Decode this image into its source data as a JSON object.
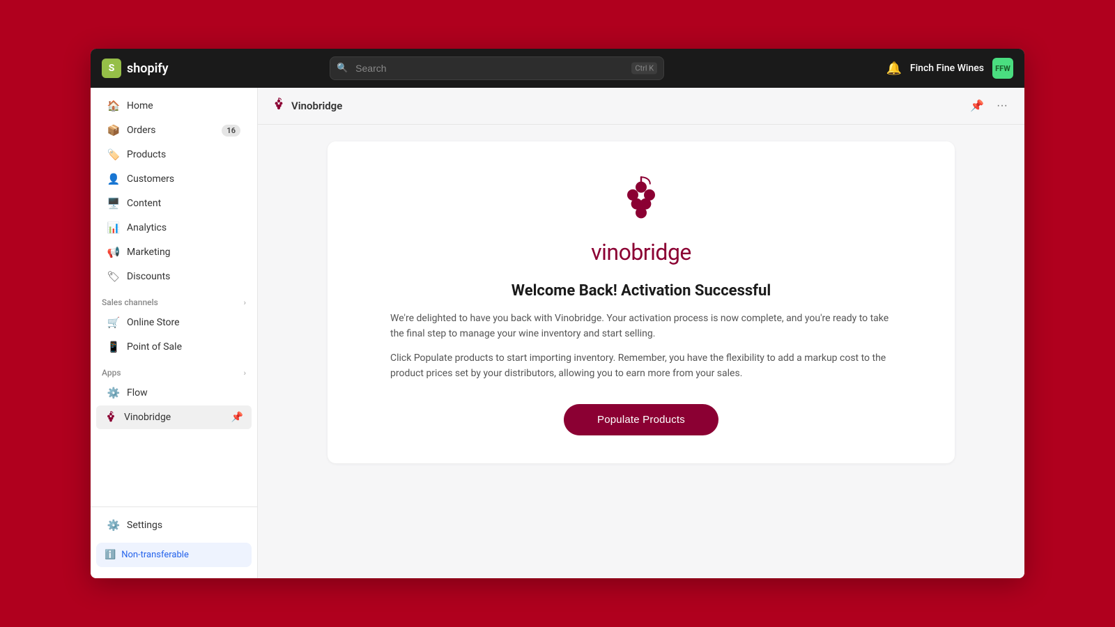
{
  "topbar": {
    "logo_text": "shopify",
    "search_placeholder": "Search",
    "search_shortcut": "Ctrl K",
    "store_name": "Finch Fine Wines",
    "store_initials": "FFW"
  },
  "sidebar": {
    "nav_items": [
      {
        "id": "home",
        "label": "Home",
        "icon": "home"
      },
      {
        "id": "orders",
        "label": "Orders",
        "icon": "orders",
        "badge": "16"
      },
      {
        "id": "products",
        "label": "Products",
        "icon": "products"
      },
      {
        "id": "customers",
        "label": "Customers",
        "icon": "customers"
      },
      {
        "id": "content",
        "label": "Content",
        "icon": "content"
      },
      {
        "id": "analytics",
        "label": "Analytics",
        "icon": "analytics"
      },
      {
        "id": "marketing",
        "label": "Marketing",
        "icon": "marketing"
      },
      {
        "id": "discounts",
        "label": "Discounts",
        "icon": "discounts"
      }
    ],
    "sales_channels_label": "Sales channels",
    "sales_channels": [
      {
        "id": "online-store",
        "label": "Online Store",
        "icon": "store"
      },
      {
        "id": "point-of-sale",
        "label": "Point of Sale",
        "icon": "pos"
      }
    ],
    "apps_label": "Apps",
    "apps": [
      {
        "id": "flow",
        "label": "Flow",
        "icon": "flow"
      },
      {
        "id": "vinobridge",
        "label": "Vinobridge",
        "icon": "grape"
      }
    ],
    "settings_label": "Settings",
    "non_transferable_label": "Non-transferable"
  },
  "content_header": {
    "title": "Vinobridge",
    "more_icon": "···"
  },
  "card": {
    "logo_text": "vinobridge",
    "title": "Welcome Back! Activation Successful",
    "paragraph1": "We're delighted to have you back with Vinobridge. Your activation process is now complete, and you're ready to take the final step to manage your wine inventory and start selling.",
    "paragraph2": "Click Populate products to start importing inventory. Remember, you have the flexibility to add a markup cost to the product prices set by your distributors, allowing you to earn more from your sales.",
    "button_label": "Populate Products"
  },
  "colors": {
    "brand_dark_red": "#8b0033",
    "shopify_green": "#96bf48",
    "store_avatar_bg": "#4ade80"
  }
}
